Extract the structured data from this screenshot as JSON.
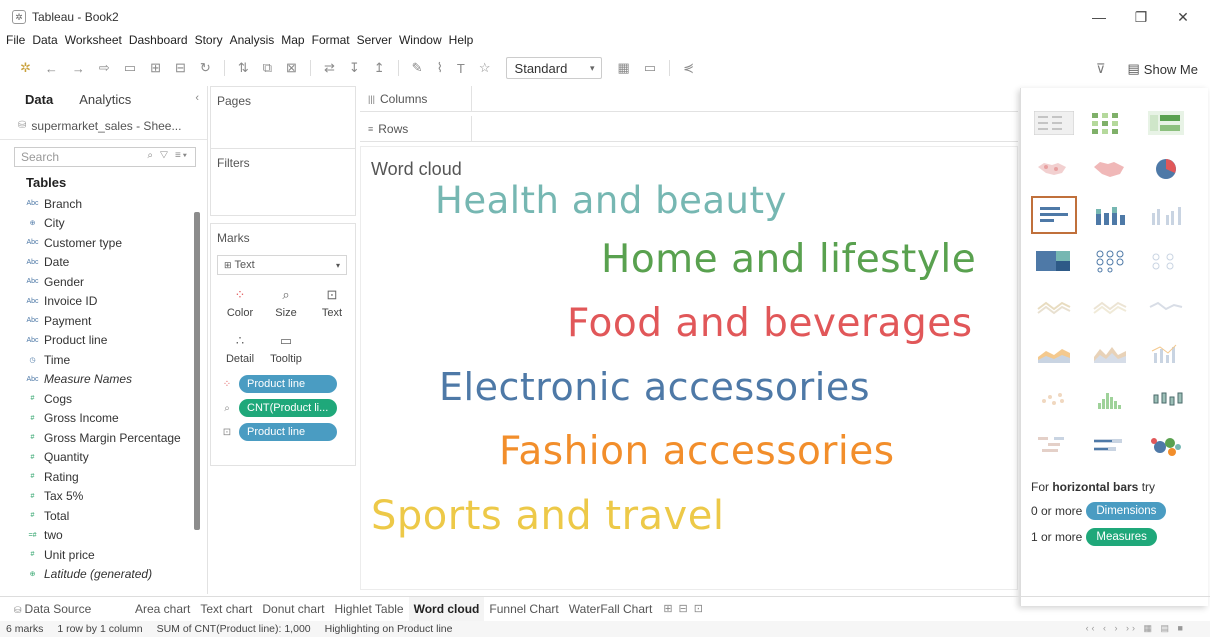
{
  "window": {
    "title": "Tableau - Book2",
    "minimize": "—",
    "restore": "❐",
    "close": "✕"
  },
  "menu": [
    "File",
    "Data",
    "Worksheet",
    "Dashboard",
    "Story",
    "Analysis",
    "Map",
    "Format",
    "Server",
    "Window",
    "Help"
  ],
  "toolbar": {
    "fit_select": "Standard",
    "show_me_label": "Show Me"
  },
  "data_pane": {
    "tab_data": "Data",
    "tab_analytics": "Analytics",
    "data_source": "supermarket_sales - Shee...",
    "search_placeholder": "Search",
    "tables_heading": "Tables",
    "fields": [
      {
        "label": "Branch",
        "type": "dim",
        "icon": "Abc"
      },
      {
        "label": "City",
        "type": "dim",
        "icon": "⊕"
      },
      {
        "label": "Customer type",
        "type": "dim",
        "icon": "Abc"
      },
      {
        "label": "Date",
        "type": "dim",
        "icon": "Abc"
      },
      {
        "label": "Gender",
        "type": "dim",
        "icon": "Abc"
      },
      {
        "label": "Invoice ID",
        "type": "dim",
        "icon": "Abc"
      },
      {
        "label": "Payment",
        "type": "dim",
        "icon": "Abc"
      },
      {
        "label": "Product line",
        "type": "dim",
        "icon": "Abc"
      },
      {
        "label": "Time",
        "type": "dim",
        "icon": "◷"
      },
      {
        "label": "Measure Names",
        "type": "dim",
        "icon": "Abc",
        "italic": true
      },
      {
        "label": "Cogs",
        "type": "meas",
        "icon": "#"
      },
      {
        "label": "Gross Income",
        "type": "meas",
        "icon": "#"
      },
      {
        "label": "Gross Margin Percentage",
        "type": "meas",
        "icon": "#"
      },
      {
        "label": "Quantity",
        "type": "meas",
        "icon": "#"
      },
      {
        "label": "Rating",
        "type": "meas",
        "icon": "#"
      },
      {
        "label": "Tax 5%",
        "type": "meas",
        "icon": "#"
      },
      {
        "label": "Total",
        "type": "meas",
        "icon": "#"
      },
      {
        "label": "two",
        "type": "meas",
        "icon": "=#"
      },
      {
        "label": "Unit price",
        "type": "meas",
        "icon": "#"
      },
      {
        "label": "Latitude (generated)",
        "type": "meas",
        "icon": "⊕",
        "italic": true
      }
    ]
  },
  "cards": {
    "pages": "Pages",
    "filters": "Filters",
    "marks": "Marks",
    "mark_type": "Text",
    "buttons": {
      "color": "Color",
      "size": "Size",
      "text": "Text",
      "detail": "Detail",
      "tooltip": "Tooltip"
    },
    "pills": [
      {
        "label": "Product line",
        "kind": "dim"
      },
      {
        "label": "CNT(Product li...",
        "kind": "meas"
      },
      {
        "label": "Product line",
        "kind": "dim"
      }
    ]
  },
  "shelves": {
    "columns": "Columns",
    "rows": "Rows"
  },
  "sheet": {
    "title": "Word cloud",
    "words": [
      {
        "text": "Health and beauty",
        "color": "#76b7b2",
        "size": 37
      },
      {
        "text": "Home and lifestyle",
        "color": "#59a14f",
        "size": 39
      },
      {
        "text": "Food and beverages",
        "color": "#e15759",
        "size": 39
      },
      {
        "text": "Electronic accessories",
        "color": "#4e79a7",
        "size": 38
      },
      {
        "text": "Fashion accessories",
        "color": "#f28e2b",
        "size": 39
      },
      {
        "text": "Sports and travel",
        "color": "#edc948",
        "size": 40
      }
    ]
  },
  "show_me": {
    "hint_prefix": "For",
    "hint_chart": "horizontal bars",
    "hint_suffix": "try",
    "dims_prefix": "0 or more",
    "dims_pill": "Dimensions",
    "meas_prefix": "1 or more",
    "meas_pill": "Measures"
  },
  "sheet_tabs": {
    "data_source": "Data Source",
    "tabs": [
      "Area chart",
      "Text chart",
      "Donut chart",
      "Highlet Table",
      "Word cloud",
      "Funnel Chart",
      "WaterFall Chart"
    ],
    "active": "Word cloud"
  },
  "status": {
    "marks": "6 marks",
    "dims": "1 row by 1 column",
    "sum": "SUM of CNT(Product line): 1,000",
    "highlight": "Highlighting on Product line"
  },
  "colors": {
    "dimension_pill": "#4a9cc2",
    "measure_pill": "#1fa87a",
    "selected_tile": "#c0703b"
  }
}
